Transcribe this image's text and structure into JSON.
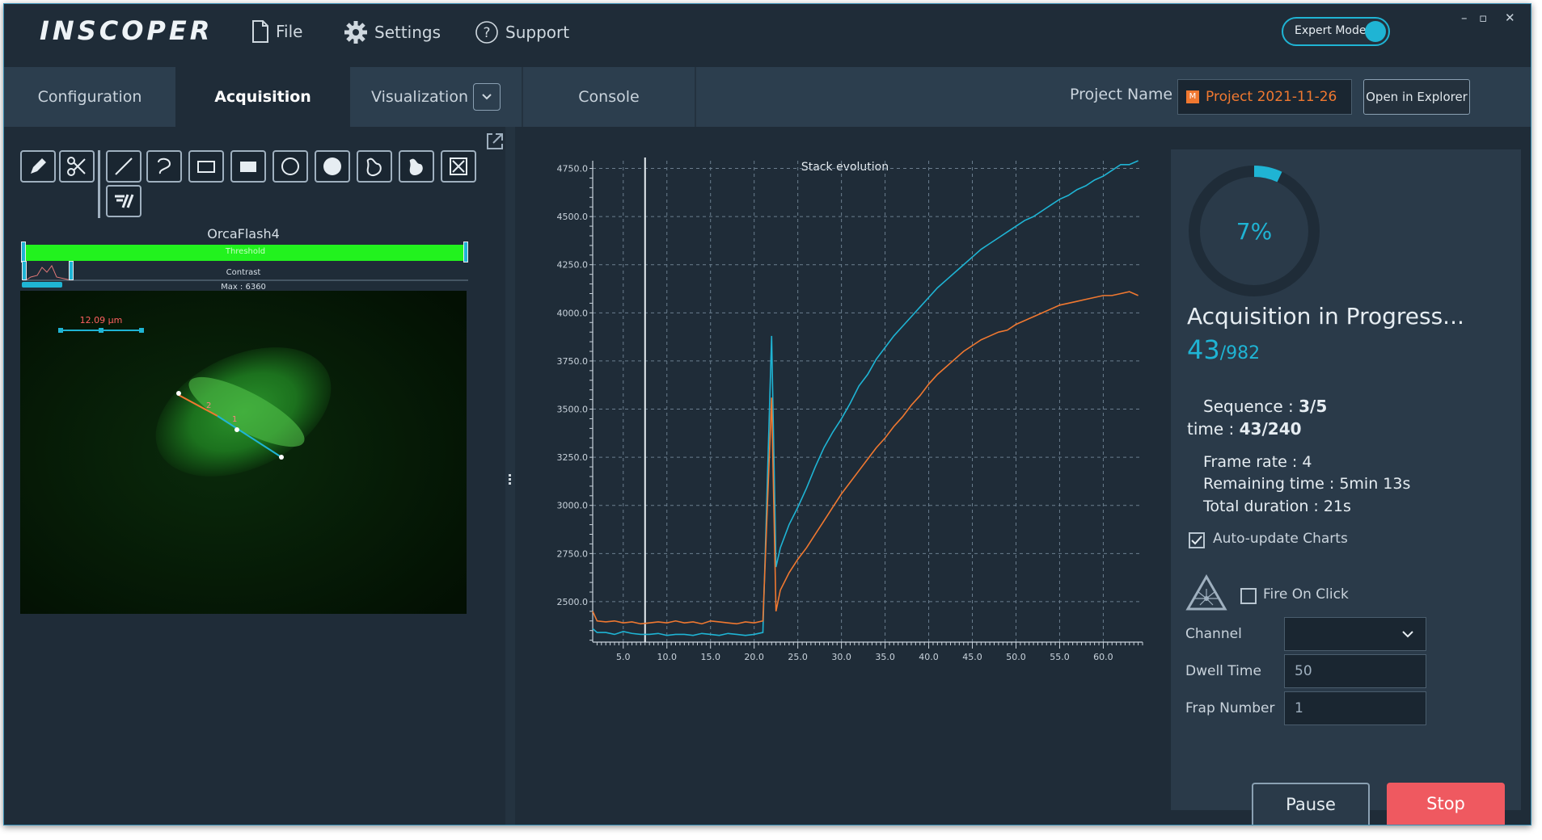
{
  "app": {
    "logo": "INSCOPER"
  },
  "menu": {
    "file": "File",
    "settings": "Settings",
    "support": "Support"
  },
  "expert_mode": {
    "label": "Expert Mode",
    "on": true
  },
  "tabs": [
    {
      "label": "Configuration"
    },
    {
      "label": "Acquisition",
      "active": true
    },
    {
      "label": "Visualization"
    },
    {
      "label": "Console"
    }
  ],
  "project": {
    "label": "Project Name",
    "value": "Project 2021-11-26",
    "open_explorer": "Open in Explorer"
  },
  "camera": {
    "name": "OrcaFlash4",
    "threshold_label": "Threshold",
    "contrast_label": "Contrast",
    "max_label": "Max : 6360",
    "scalebar_label": "12.09 µm",
    "line_markers": [
      "2",
      "1"
    ]
  },
  "chart_data": {
    "type": "line",
    "title": "Stack evolution",
    "xlabel": "",
    "ylabel": "",
    "xlim": [
      1.5,
      64.5
    ],
    "ylim": [
      2290,
      4790
    ],
    "x_ticks": [
      "5.0",
      "10.0",
      "15.0",
      "20.0",
      "25.0",
      "30.0",
      "35.0",
      "40.0",
      "45.0",
      "50.0",
      "55.0",
      "60.0"
    ],
    "y_ticks": [
      "4750.0",
      "4500.0",
      "4250.0",
      "4000.0",
      "3750.0",
      "3500.0",
      "3250.0",
      "3000.0",
      "2750.0",
      "2500.0"
    ],
    "grid": true,
    "cursor_x": 7.5,
    "series": [
      {
        "color": "#1fb4d4",
        "x": [
          1,
          2,
          3,
          4,
          5,
          6,
          7,
          8,
          9,
          10,
          11,
          12,
          13,
          14,
          15,
          16,
          17,
          18,
          19,
          20,
          21,
          22,
          22.5,
          23,
          24,
          25,
          26,
          27,
          28,
          29,
          30,
          31,
          32,
          33,
          34,
          35,
          36,
          37,
          38,
          39,
          40,
          41,
          42,
          43,
          44,
          45,
          46,
          47,
          48,
          49,
          50,
          51,
          52,
          53,
          54,
          55,
          56,
          57,
          58,
          59,
          60,
          61,
          62,
          63,
          64
        ],
        "y": [
          2360,
          2340,
          2340,
          2330,
          2345,
          2335,
          2330,
          2330,
          2335,
          2325,
          2330,
          2330,
          2325,
          2335,
          2330,
          2325,
          2335,
          2330,
          2325,
          2330,
          2340,
          3880,
          2680,
          2780,
          2900,
          2990,
          3090,
          3200,
          3300,
          3380,
          3450,
          3530,
          3620,
          3680,
          3760,
          3820,
          3880,
          3930,
          3980,
          4030,
          4080,
          4130,
          4170,
          4210,
          4250,
          4290,
          4330,
          4360,
          4390,
          4420,
          4450,
          4480,
          4500,
          4530,
          4560,
          4590,
          4610,
          4640,
          4660,
          4690,
          4710,
          4740,
          4770,
          4770,
          4790
        ]
      },
      {
        "color": "#f07830",
        "x": [
          1,
          2,
          3,
          4,
          5,
          6,
          7,
          8,
          9,
          10,
          11,
          12,
          13,
          14,
          15,
          16,
          17,
          18,
          19,
          20,
          21,
          22,
          22.5,
          23,
          24,
          25,
          26,
          27,
          28,
          29,
          30,
          31,
          32,
          33,
          34,
          35,
          36,
          37,
          38,
          39,
          40,
          41,
          42,
          43,
          44,
          45,
          46,
          47,
          48,
          49,
          50,
          51,
          52,
          53,
          54,
          55,
          56,
          57,
          58,
          59,
          60,
          61,
          62,
          63,
          64
        ],
        "y": [
          2450,
          2400,
          2395,
          2400,
          2390,
          2395,
          2385,
          2390,
          2395,
          2390,
          2400,
          2390,
          2395,
          2385,
          2400,
          2395,
          2390,
          2385,
          2395,
          2390,
          2400,
          3560,
          2450,
          2560,
          2650,
          2720,
          2780,
          2850,
          2920,
          2990,
          3060,
          3120,
          3180,
          3240,
          3300,
          3350,
          3410,
          3460,
          3520,
          3570,
          3630,
          3680,
          3720,
          3760,
          3800,
          3830,
          3860,
          3880,
          3900,
          3910,
          3940,
          3960,
          3980,
          4000,
          4020,
          4040,
          4050,
          4060,
          4070,
          4080,
          4090,
          4090,
          4100,
          4110,
          4090
        ]
      }
    ]
  },
  "progress": {
    "percent": 7,
    "percent_text": "7%",
    "title": "Acquisition in Progress...",
    "current": "43",
    "total": "/982"
  },
  "status": {
    "sequence_label": "Sequence : ",
    "sequence_value": "3/5",
    "time_label": "time : ",
    "time_value": "43/240",
    "frame_rate": "Frame rate : 4",
    "remaining": "Remaining time : 5min 13s",
    "duration": "Total duration : 21s",
    "auto_update": "Auto-update Charts",
    "auto_update_checked": true
  },
  "frap": {
    "fire_on_click": "Fire On Click",
    "fire_checked": false,
    "channel_label": "Channel",
    "channel_value": "",
    "dwell_label": "Dwell Time",
    "dwell_value": "50",
    "frap_label": "Frap Number",
    "frap_value": "1"
  },
  "actions": {
    "pause": "Pause",
    "stop": "Stop"
  },
  "colors": {
    "accent": "#1fb4d4",
    "orange": "#f07830",
    "stop": "#ef5960",
    "bg": "#1f2c38",
    "panel": "#2a3a49"
  }
}
